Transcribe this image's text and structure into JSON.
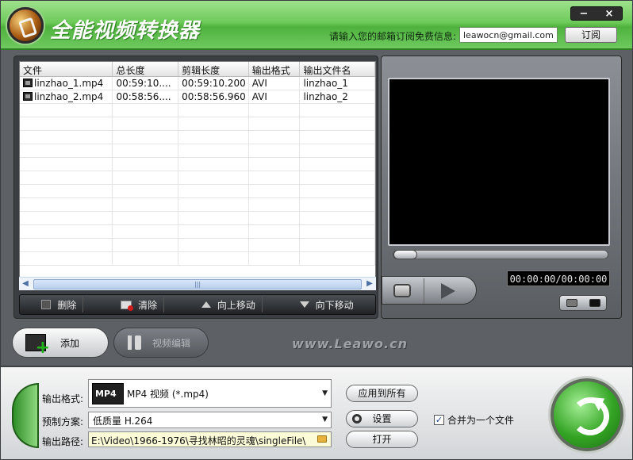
{
  "window": {
    "title": "全能视频转换器",
    "email_prompt": "请输入您的邮箱订阅免费信息:",
    "email_value": "leawocn@gmail.com",
    "subscribe_label": "订阅",
    "minimize_glyph": "−",
    "close_glyph": "×"
  },
  "file_list": {
    "columns": [
      "文件",
      "总长度",
      "剪辑长度",
      "输出格式",
      "输出文件名"
    ],
    "rows": [
      [
        "linzhao_1.mp4",
        "00:59:10....",
        "00:59:10.200",
        "AVI",
        "linzhao_1"
      ],
      [
        "linzhao_2.mp4",
        "00:58:56....",
        "00:58:56.960",
        "AVI",
        "linzhao_2"
      ]
    ],
    "scroll_thumb_glyph": "|||",
    "toolbar": {
      "delete_label": "删除",
      "clear_label": "清除",
      "move_up_label": "向上移动",
      "move_down_label": "向下移动"
    }
  },
  "preview": {
    "time_display": "00:00:00/00:00:00",
    "seek_fraction": 0
  },
  "actions": {
    "add_label": "添加",
    "edit_label": "视频编辑",
    "watermark": "www.Leawo.cn"
  },
  "output": {
    "format_label": "输出格式:",
    "format_icon": "MP4",
    "format_value": "MP4 视频 (*.mp4)",
    "preset_label": "预制方案:",
    "preset_value": "低质量 H.264",
    "path_label": "输出路径:",
    "path_value": "E:\\Video\\1966-1976\\寻找林昭的灵魂\\singleFile\\",
    "apply_all_label": "应用到所有",
    "settings_label": "设置",
    "open_label": "打开",
    "merge_label": "合并为一个文件",
    "merge_checked": "✓"
  },
  "colors": {
    "title_green": "#6ecb5a",
    "panel_dark": "#3b3e42",
    "convert_green": "#34a424"
  },
  "icons": [
    "logo-icon",
    "film-icon",
    "delete-icon",
    "clear-icon",
    "move-up-icon",
    "move-down-icon",
    "stop-icon",
    "play-icon",
    "camera-icon",
    "add-video-icon",
    "tools-icon",
    "mp4-icon",
    "folder-icon",
    "gear-icon",
    "convert-icon"
  ]
}
